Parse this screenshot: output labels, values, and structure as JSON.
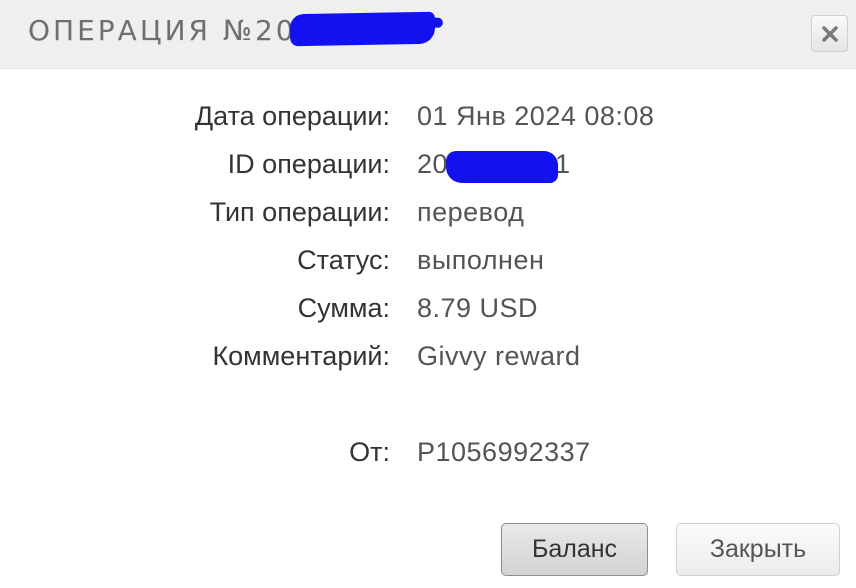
{
  "dialog": {
    "title": "ОПЕРАЦИЯ №200",
    "close_icon": "close-icon",
    "redaction_color": "#1212f0"
  },
  "fields": {
    "date": {
      "label": "Дата операции:",
      "value": "01 Янв 2024 08:08"
    },
    "id": {
      "label": "ID операции:",
      "value_prefix": "20",
      "value_suffix": "1"
    },
    "type": {
      "label": "Тип операции:",
      "value": "перевод"
    },
    "status": {
      "label": "Статус:",
      "value": "выполнен"
    },
    "amount": {
      "label": "Сумма:",
      "value": "8.79 USD"
    },
    "comment": {
      "label": "Комментарий:",
      "value": "Givvy reward"
    },
    "from": {
      "label": "От:",
      "value": "P1056992337"
    }
  },
  "buttons": {
    "balance_label": "Баланс",
    "close_label": "Закрыть"
  }
}
